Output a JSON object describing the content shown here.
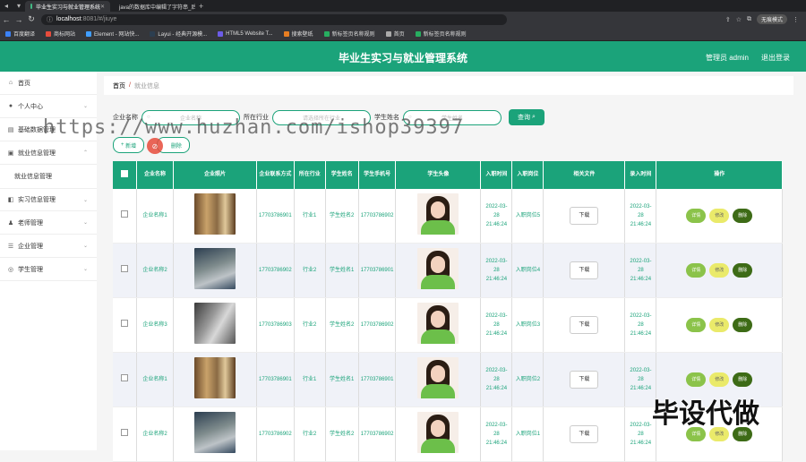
{
  "browser": {
    "tabs": [
      {
        "title": "毕业生实习与就业管理系统",
        "active": true,
        "icon_color": "#42b883"
      },
      {
        "title": "java的数据库中编辑了字符串_后台...",
        "active": false,
        "icon_color": "#4a6fe3"
      }
    ],
    "url_host": "localhost",
    "url_path": ":8081/#/jiuye",
    "incognito_label": "无痕模式",
    "bookmarks": [
      "百度翻译",
      "商标网站",
      "Element - 网站快...",
      "Layui - 经典开源模...",
      "HTML5 Website T...",
      "搜索壁纸",
      "新标签页名称规则",
      "首页",
      "新标签页名称规则"
    ]
  },
  "header": {
    "title": "毕业生实习与就业管理系统",
    "user_label": "管理员 admin",
    "logout_label": "退出登录"
  },
  "sidebar": {
    "items": [
      {
        "label": "首页",
        "icon": "home-icon",
        "expandable": false
      },
      {
        "label": "个人中心",
        "icon": "user-icon",
        "expandable": true
      },
      {
        "label": "基础数据管理",
        "icon": "database-icon",
        "expandable": true
      },
      {
        "label": "就业信息管理",
        "icon": "briefcase-icon",
        "expandable": true
      },
      {
        "label": "就业信息管理",
        "icon": "",
        "expandable": false,
        "sub": true
      },
      {
        "label": "实习信息管理",
        "icon": "book-icon",
        "expandable": true
      },
      {
        "label": "老师管理",
        "icon": "teacher-icon",
        "expandable": true
      },
      {
        "label": "企业管理",
        "icon": "building-icon",
        "expandable": true
      },
      {
        "label": "学生管理",
        "icon": "student-icon",
        "expandable": true
      }
    ]
  },
  "breadcrumb": {
    "home": "首页",
    "separator": "/",
    "current": "就业信息"
  },
  "search": {
    "company_label": "企业名称",
    "company_placeholder": "企业名称",
    "industry_label": "所在行业",
    "industry_placeholder": "请选择所在行业",
    "student_label": "学生姓名",
    "student_placeholder": "学生姓名",
    "search_button": "查询"
  },
  "actions": {
    "add": "新增",
    "delete": "删除"
  },
  "table": {
    "headers": [
      "企业名称",
      "企业照片",
      "企业联系方式",
      "所在行业",
      "学生姓名",
      "学生手机号",
      "学生头像",
      "入职时间",
      "入职岗位",
      "相关文件",
      "录入时间",
      "操作"
    ],
    "download_label": "下载",
    "op_labels": {
      "detail": "详情",
      "edit": "修改",
      "delete": "删除"
    },
    "rows": [
      {
        "company": "企业名称1",
        "photo": "a",
        "contact": "17703786901",
        "industry": "行业1",
        "student": "学生姓名2",
        "phone": "17703786902",
        "join_time": "2022-03-28 21:46:24",
        "post": "入职岗位5",
        "entry_time": "2022-03-28 21:46:24"
      },
      {
        "company": "企业名称2",
        "photo": "b",
        "contact": "17703786902",
        "industry": "行业2",
        "student": "学生姓名1",
        "phone": "17703786901",
        "join_time": "2022-03-28 21:46:24",
        "post": "入职岗位4",
        "entry_time": "2022-03-28 21:46:24"
      },
      {
        "company": "企业名称3",
        "photo": "c",
        "contact": "17703786903",
        "industry": "行业2",
        "student": "学生姓名2",
        "phone": "17703786902",
        "join_time": "2022-03-28 21:46:24",
        "post": "入职岗位3",
        "entry_time": "2022-03-28 21:46:24"
      },
      {
        "company": "企业名称1",
        "photo": "a",
        "contact": "17703786901",
        "industry": "行业1",
        "student": "学生姓名1",
        "phone": "17703786901",
        "join_time": "2022-03-28 21:46:24",
        "post": "入职岗位2",
        "entry_time": "2022-03-28 21:46:24"
      },
      {
        "company": "企业名称2",
        "photo": "b",
        "contact": "17703786902",
        "industry": "行业2",
        "student": "学生姓名2",
        "phone": "17703786902",
        "join_time": "2022-03-28 21:46:24",
        "post": "入职岗位1",
        "entry_time": "2022-03-28 21:46:24"
      }
    ]
  },
  "watermarks": {
    "url_text": "https://www.huzhan.com/ishop39397",
    "corner_text": "毕设代做"
  },
  "colors": {
    "primary": "#1ba37a",
    "detail": "#8bc34a",
    "edit": "#eaea6a",
    "delete": "#3d6b16"
  }
}
